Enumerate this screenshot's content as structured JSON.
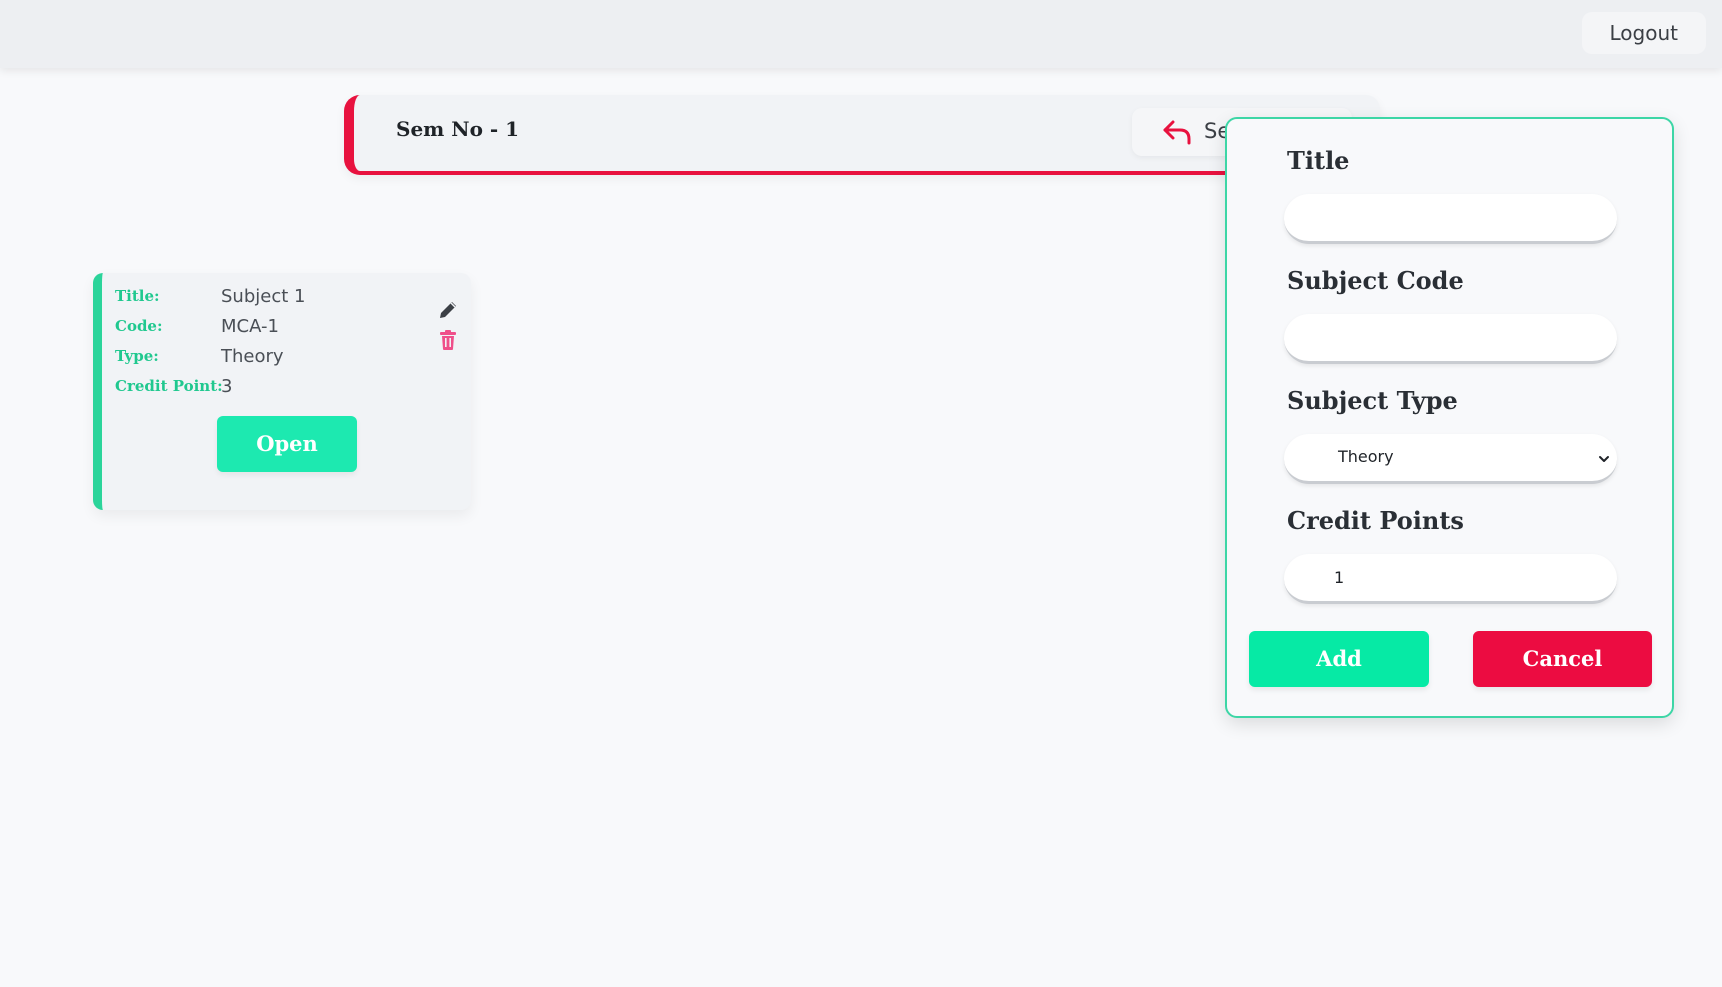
{
  "topbar": {
    "logout_label": "Logout"
  },
  "semester": {
    "title": "Sem No - 1",
    "back_label": "Ser",
    "accent_color": "#e8123f"
  },
  "subject_card": {
    "accent_color": "#2bd49a",
    "rows": [
      {
        "label": "Title:",
        "value": "Subject 1"
      },
      {
        "label": "Code:",
        "value": "MCA-1"
      },
      {
        "label": "Type:",
        "value": "Theory"
      },
      {
        "label": "Credit Point:",
        "value": "3"
      }
    ],
    "open_label": "Open",
    "edit_icon": "pencil-icon",
    "delete_icon": "trash-icon"
  },
  "modal": {
    "border_color": "#3dd6a6",
    "title_label": "Title",
    "title_value": "",
    "code_label": "Subject Code",
    "code_value": "",
    "type_label": "Subject Type",
    "type_value": "Theory",
    "credit_label": "Credit Points",
    "credit_value": "1",
    "add_label": "Add",
    "cancel_label": "Cancel",
    "add_color": "#06eaa5",
    "cancel_color": "#ec0c41"
  }
}
